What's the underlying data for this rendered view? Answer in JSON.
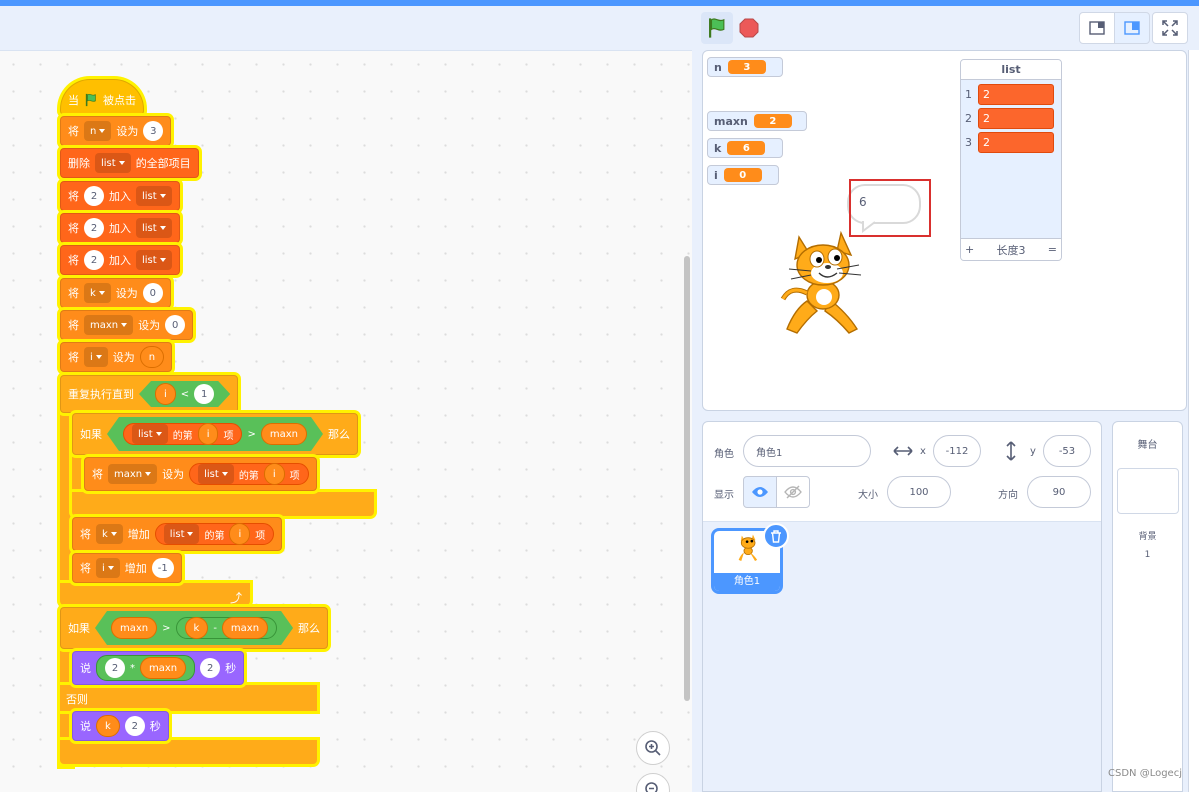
{
  "code": {
    "hat": {
      "when": "当",
      "clicked": "被点击"
    },
    "set_n": {
      "verb": "将",
      "var": "n",
      "op": "设为",
      "value": "3"
    },
    "delete_all": {
      "verb": "删除",
      "list": "list",
      "suffix": "的全部项目"
    },
    "add1": {
      "verb": "将",
      "value": "2",
      "op": "加入",
      "list": "list"
    },
    "add2": {
      "verb": "将",
      "value": "2",
      "op": "加入",
      "list": "list"
    },
    "add3": {
      "verb": "将",
      "value": "2",
      "op": "加入",
      "list": "list"
    },
    "set_k": {
      "verb": "将",
      "var": "k",
      "op": "设为",
      "value": "0"
    },
    "set_maxn": {
      "verb": "将",
      "var": "maxn",
      "op": "设为",
      "value": "0"
    },
    "set_i": {
      "verb": "将",
      "var": "i",
      "op": "设为",
      "value": "n"
    },
    "repeat": {
      "label": "重复执行直到",
      "left": "i",
      "cmp": "<",
      "right": "1"
    },
    "if1": {
      "label": "如果",
      "list": "list",
      "of": "的第",
      "idx": "i",
      "item": "项",
      "cmp": ">",
      "right": "maxn",
      "then": "那么"
    },
    "set_maxn2": {
      "verb": "将",
      "var": "maxn",
      "op": "设为",
      "list": "list",
      "of": "的第",
      "idx": "i",
      "item": "项"
    },
    "change_k": {
      "verb": "将",
      "var": "k",
      "op": "增加",
      "list": "list",
      "of": "的第",
      "idx": "i",
      "item": "项"
    },
    "change_i": {
      "verb": "将",
      "var": "i",
      "op": "增加",
      "value": "-1"
    },
    "if2": {
      "label": "如果",
      "left": "maxn",
      "cmp": ">",
      "a": "k",
      "minus": "-",
      "b": "maxn",
      "then": "那么"
    },
    "say1": {
      "verb": "说",
      "a": "2",
      "mul": "*",
      "b": "maxn",
      "secs": "2",
      "unit": "秒"
    },
    "else": "否则",
    "say2": {
      "verb": "说",
      "value": "k",
      "secs": "2",
      "unit": "秒"
    }
  },
  "stage": {
    "monitors": [
      {
        "name": "n",
        "value": "3"
      },
      {
        "name": "maxn",
        "value": "2"
      },
      {
        "name": "k",
        "value": "6"
      },
      {
        "name": "i",
        "value": "0"
      }
    ],
    "list_monitor": {
      "title": "list",
      "items": [
        {
          "index": "1",
          "value": "2"
        },
        {
          "index": "2",
          "value": "2"
        },
        {
          "index": "3",
          "value": "2"
        }
      ],
      "add": "+",
      "length": "长度3",
      "resize": "="
    },
    "bubble": "6"
  },
  "sprite_info": {
    "sprite_label": "角色",
    "sprite_name": "角色1",
    "x_label": "x",
    "x": "-112",
    "y_label": "y",
    "y": "-53",
    "show_label": "显示",
    "size_label": "大小",
    "size": "100",
    "direction_label": "方向",
    "direction": "90"
  },
  "sprites": [
    {
      "name": "角色1"
    }
  ],
  "stage_panel": {
    "title": "舞台",
    "backdrops_label": "背景",
    "backdrops_count": "1"
  },
  "watermark": "CSDN @Logecj",
  "colors": {
    "accent": "#4c97ff",
    "event": "#ffbf00",
    "variable": "#ff8c1a",
    "list": "#ff661a",
    "control": "#ffab19",
    "operator": "#59c059",
    "looks": "#9966ff",
    "highlight": "#fff200"
  }
}
